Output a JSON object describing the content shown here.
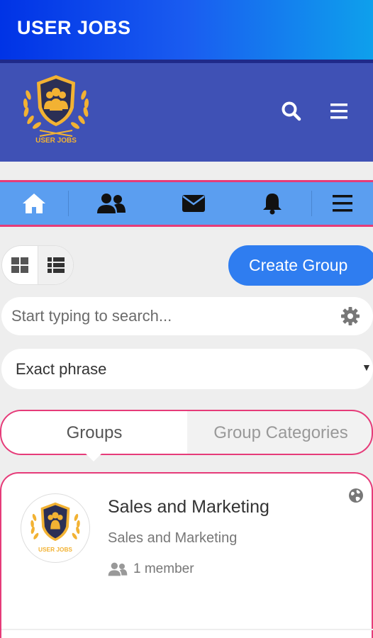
{
  "appbar": {
    "title": "USER JOBS"
  },
  "header": {
    "logo_text": "USER JOBS",
    "search_icon": "search-icon",
    "menu_icon": "menu-icon"
  },
  "nav": {
    "items": [
      {
        "icon": "home-icon"
      },
      {
        "icon": "users-icon"
      },
      {
        "icon": "envelope-icon"
      },
      {
        "icon": "bell-icon"
      },
      {
        "icon": "menu-icon"
      }
    ]
  },
  "toolbar": {
    "grid_view_icon": "grid-icon",
    "list_view_icon": "list-icon",
    "create_label": "Create Group"
  },
  "search": {
    "placeholder": "Start typing to search...",
    "settings_icon": "gear-icon"
  },
  "filter": {
    "selected": "Exact phrase"
  },
  "tabs": [
    {
      "label": "Groups",
      "active": true
    },
    {
      "label": "Group Categories",
      "active": false
    }
  ],
  "groups": [
    {
      "name": "Sales and Marketing",
      "category": "Sales and Marketing",
      "members": "1 member",
      "avatar_text": "USER JOBS",
      "privacy_icon": "globe-icon"
    }
  ],
  "colors": {
    "appbar_start": "#0033e6",
    "appbar_end": "#0ea0ec",
    "header": "#3f51b5",
    "navbar": "#5b9ef0",
    "accent_pink": "#e63b79",
    "button_blue": "#2f7df0",
    "logo_gold": "#f2b233"
  }
}
